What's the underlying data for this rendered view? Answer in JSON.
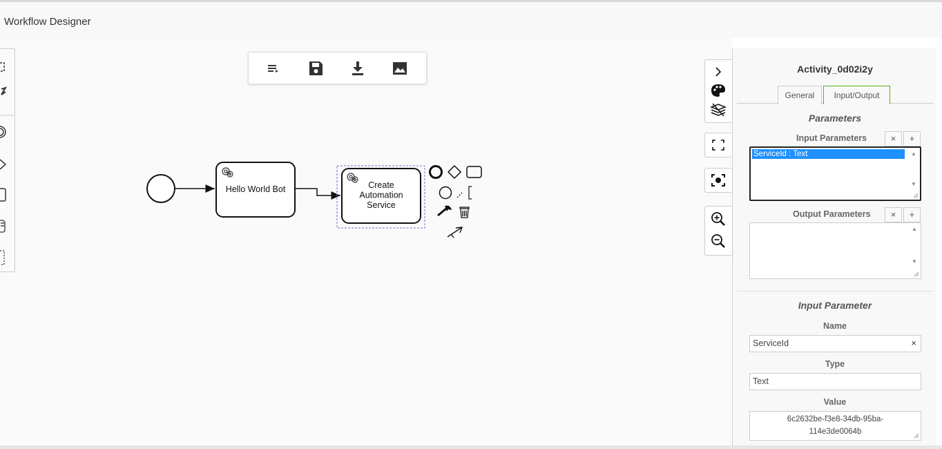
{
  "app": {
    "title": "Workflow Designer"
  },
  "toolbar": {
    "buttons": [
      {
        "name": "list-icon"
      },
      {
        "name": "save-icon"
      },
      {
        "name": "download-icon"
      },
      {
        "name": "image-icon"
      }
    ]
  },
  "diagram": {
    "tasks": [
      {
        "label_lines": [
          "Hello World Bot"
        ]
      },
      {
        "label_lines": [
          "Create",
          "Automation",
          "Service"
        ]
      }
    ]
  },
  "panel": {
    "title": "Activity_0d02i2y",
    "tabs": [
      {
        "label": "General",
        "active": false
      },
      {
        "label": "Input/Output",
        "active": true
      }
    ],
    "parameters_heading": "Parameters",
    "input_parameters_label": "Input Parameters",
    "input_parameters_items": [
      "ServiceId : Text"
    ],
    "output_parameters_label": "Output Parameters",
    "remove_symbol": "×",
    "add_symbol": "+",
    "input_parameter_heading": "Input Parameter",
    "name_label": "Name",
    "name_value": "ServiceId",
    "type_label": "Type",
    "type_value": "Text",
    "value_label": "Value",
    "value_line1": "6c2632be-f3e8-34db-95ba-",
    "value_line2": "114e3de0064b"
  },
  "colors": {
    "accent_tab": "#52b415",
    "selection": "#1e90ff",
    "selected_outline": "#6f6fcf"
  }
}
